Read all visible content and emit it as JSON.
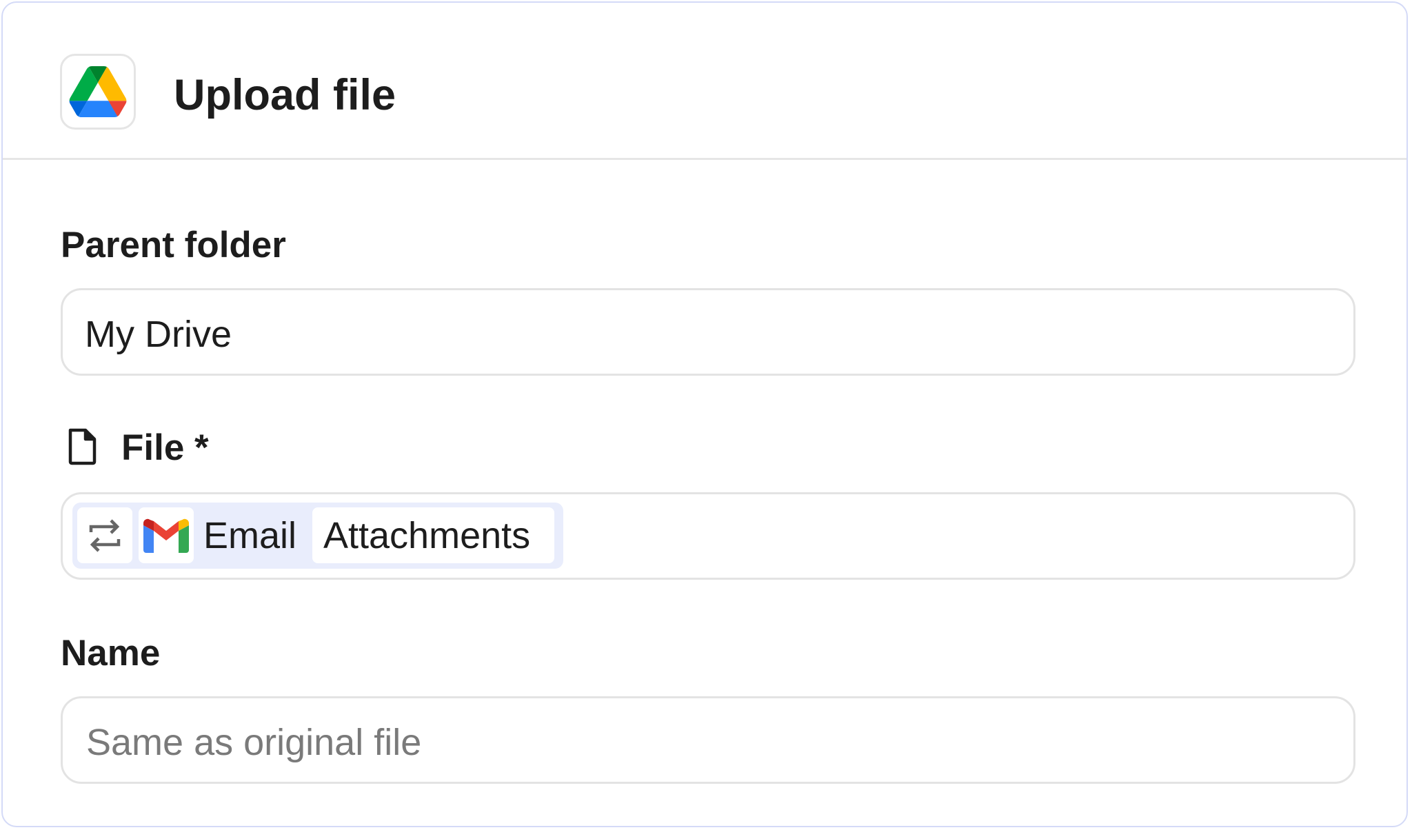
{
  "dialog": {
    "title": "Upload file",
    "app_icon": "google-drive-icon"
  },
  "fields": {
    "parent_folder": {
      "label": "Parent folder",
      "value": "My Drive"
    },
    "file": {
      "label": "File *",
      "icon": "file-icon",
      "token": {
        "swap_icon": "swap-arrows-icon",
        "source_icon": "gmail-icon",
        "source_label": "Email",
        "value": "Attachments"
      }
    },
    "name": {
      "label": "Name",
      "placeholder": "Same as original file"
    }
  },
  "colors": {
    "card_border": "#d4daf7",
    "token_background": "#e9edfc",
    "input_border": "#e3e3e3",
    "placeholder_text": "#7a7a7a"
  }
}
